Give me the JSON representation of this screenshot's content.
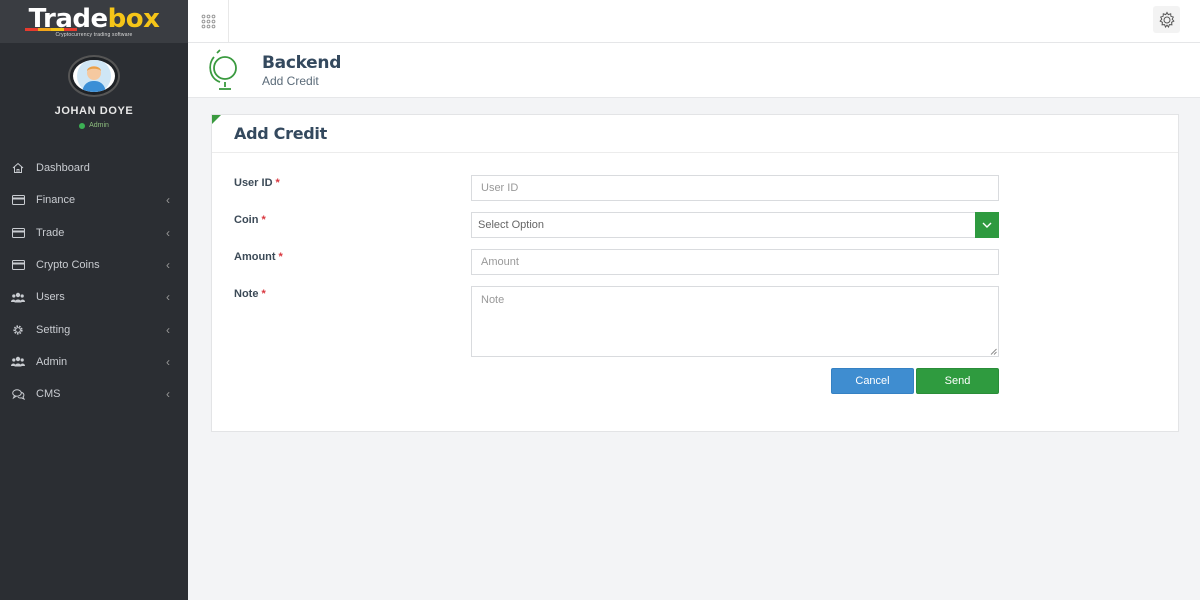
{
  "brand": {
    "logo_white": "Trade",
    "logo_yellow": "box",
    "tagline": "Cryptocurrency trading software"
  },
  "profile": {
    "name": "JOHAN DOYE",
    "role": "Admin"
  },
  "sidebar": {
    "items": [
      {
        "label": "Dashboard",
        "icon": "home-icon",
        "has_children": false
      },
      {
        "label": "Finance",
        "icon": "card-icon",
        "has_children": true
      },
      {
        "label": "Trade",
        "icon": "card-icon",
        "has_children": true
      },
      {
        "label": "Crypto Coins",
        "icon": "card-icon",
        "has_children": true
      },
      {
        "label": "Users",
        "icon": "users-icon",
        "has_children": true
      },
      {
        "label": "Setting",
        "icon": "gear-icon",
        "has_children": true
      },
      {
        "label": "Admin",
        "icon": "users-icon",
        "has_children": true
      },
      {
        "label": "CMS",
        "icon": "chat-icon",
        "has_children": true
      }
    ],
    "chevron": "‹"
  },
  "header": {
    "title": "Backend",
    "subtitle": "Add Credit"
  },
  "form": {
    "title": "Add Credit",
    "required_mark": "*",
    "user_id": {
      "label": "User ID",
      "placeholder": "User ID",
      "value": ""
    },
    "coin": {
      "label": "Coin",
      "selected": "Select Option"
    },
    "amount": {
      "label": "Amount",
      "placeholder": "Amount",
      "value": ""
    },
    "note": {
      "label": "Note",
      "placeholder": "Note",
      "value": ""
    },
    "cancel_label": "Cancel",
    "send_label": "Send"
  },
  "colors": {
    "accent_green": "#2e9a3f",
    "cancel_blue": "#3f8dd0",
    "sidebar_bg": "#2b2e33",
    "logo_yellow": "#f5c518"
  }
}
